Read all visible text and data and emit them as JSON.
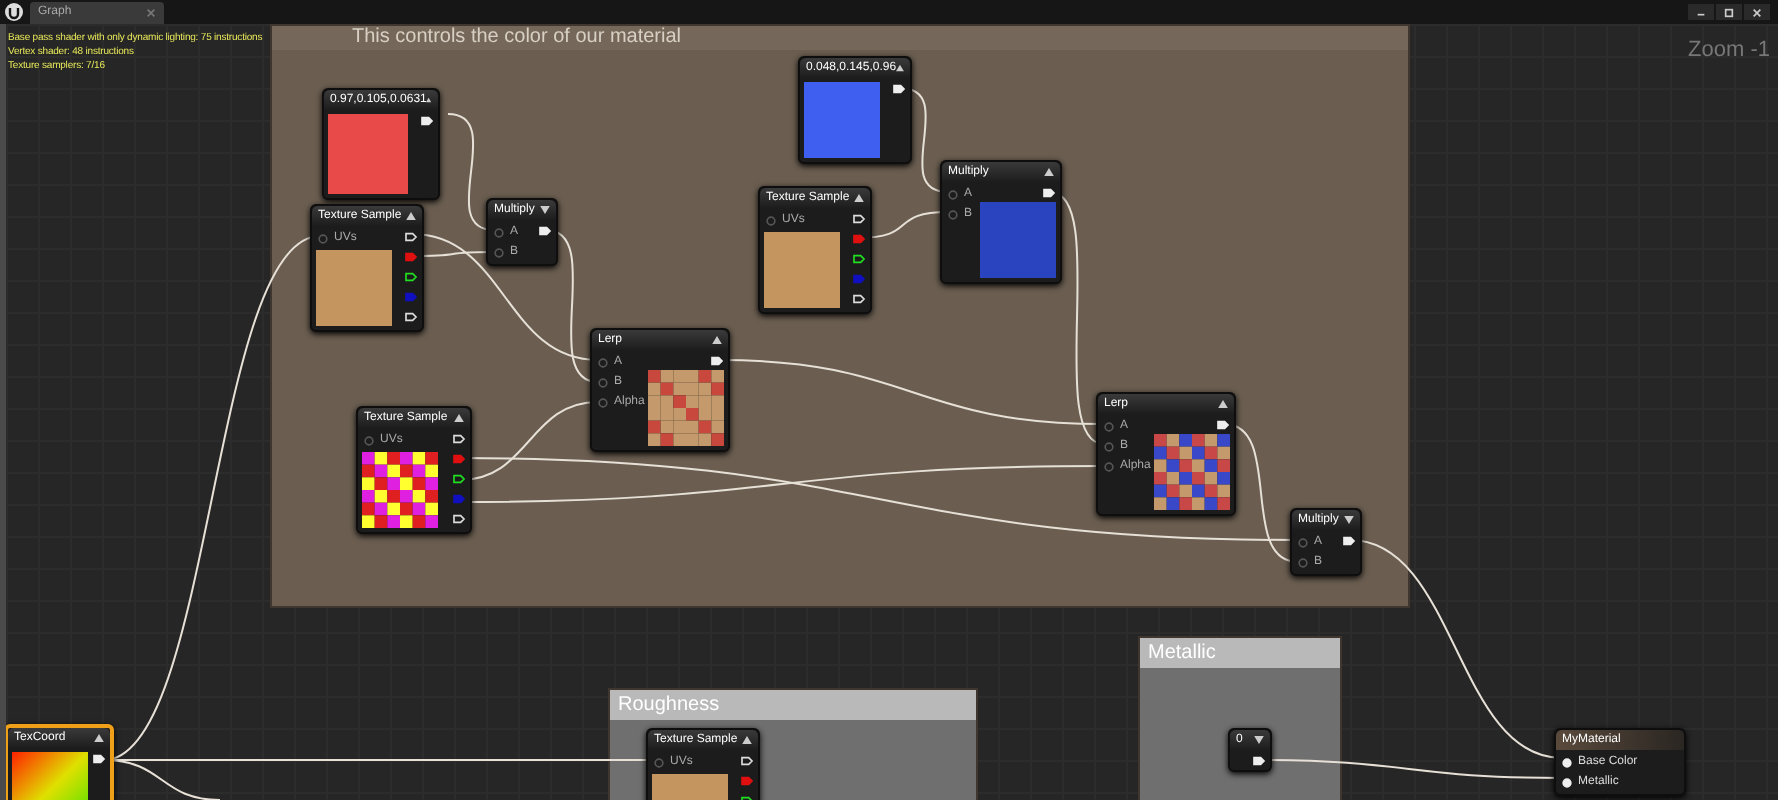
{
  "tab": {
    "label": "Graph",
    "selected": true
  },
  "stats": [
    "Base pass shader with only dynamic lighting: 75 instructions",
    "Vertex shader: 48 instructions",
    "Texture samplers: 7/16"
  ],
  "zoom": "Zoom -1",
  "comments": [
    {
      "title": "This controls the color of our material"
    },
    {
      "title": "Roughness"
    },
    {
      "title": "Metallic"
    }
  ],
  "nodes": [
    {
      "kind": "constant",
      "title": "0.97,0.105,0.0631",
      "color": "#e84a4a",
      "expanded": true,
      "selected": false
    },
    {
      "kind": "texture",
      "title": "Texture Sample",
      "inputs": [
        "UVs"
      ],
      "expanded": true,
      "selected": false
    },
    {
      "kind": "math",
      "title": "Multiply",
      "inputs": [
        "A",
        "B"
      ],
      "expanded": false,
      "selected": false
    },
    {
      "kind": "constant",
      "title": "0.048,0.145,0.96",
      "color": "#3f5ff0",
      "expanded": true,
      "selected": false
    },
    {
      "kind": "texture",
      "title": "Texture Sample",
      "inputs": [
        "UVs"
      ],
      "expanded": true,
      "selected": false
    },
    {
      "kind": "math",
      "title": "Multiply",
      "inputs": [
        "A",
        "B"
      ],
      "expanded": true,
      "selected": false
    },
    {
      "kind": "math",
      "title": "Lerp",
      "inputs": [
        "A",
        "B",
        "Alpha"
      ],
      "expanded": true,
      "selected": false
    },
    {
      "kind": "texture",
      "title": "Texture Sample",
      "inputs": [
        "UVs"
      ],
      "expanded": true,
      "selected": false
    },
    {
      "kind": "math",
      "title": "Lerp",
      "inputs": [
        "A",
        "B",
        "Alpha"
      ],
      "expanded": true,
      "selected": false
    },
    {
      "kind": "math",
      "title": "Multiply",
      "inputs": [
        "A",
        "B"
      ],
      "expanded": false,
      "selected": false
    },
    {
      "kind": "constant",
      "title": "TexCoord",
      "expanded": true,
      "selected": true
    },
    {
      "kind": "texture",
      "title": "Texture Sample",
      "inputs": [
        "UVs"
      ],
      "expanded": true,
      "selected": false
    },
    {
      "kind": "constant",
      "title": "0",
      "expanded": false,
      "selected": false
    },
    {
      "kind": "result",
      "title": "MyMaterial",
      "inputs": [
        "Base Color",
        "Metallic"
      ],
      "selected": false
    }
  ]
}
